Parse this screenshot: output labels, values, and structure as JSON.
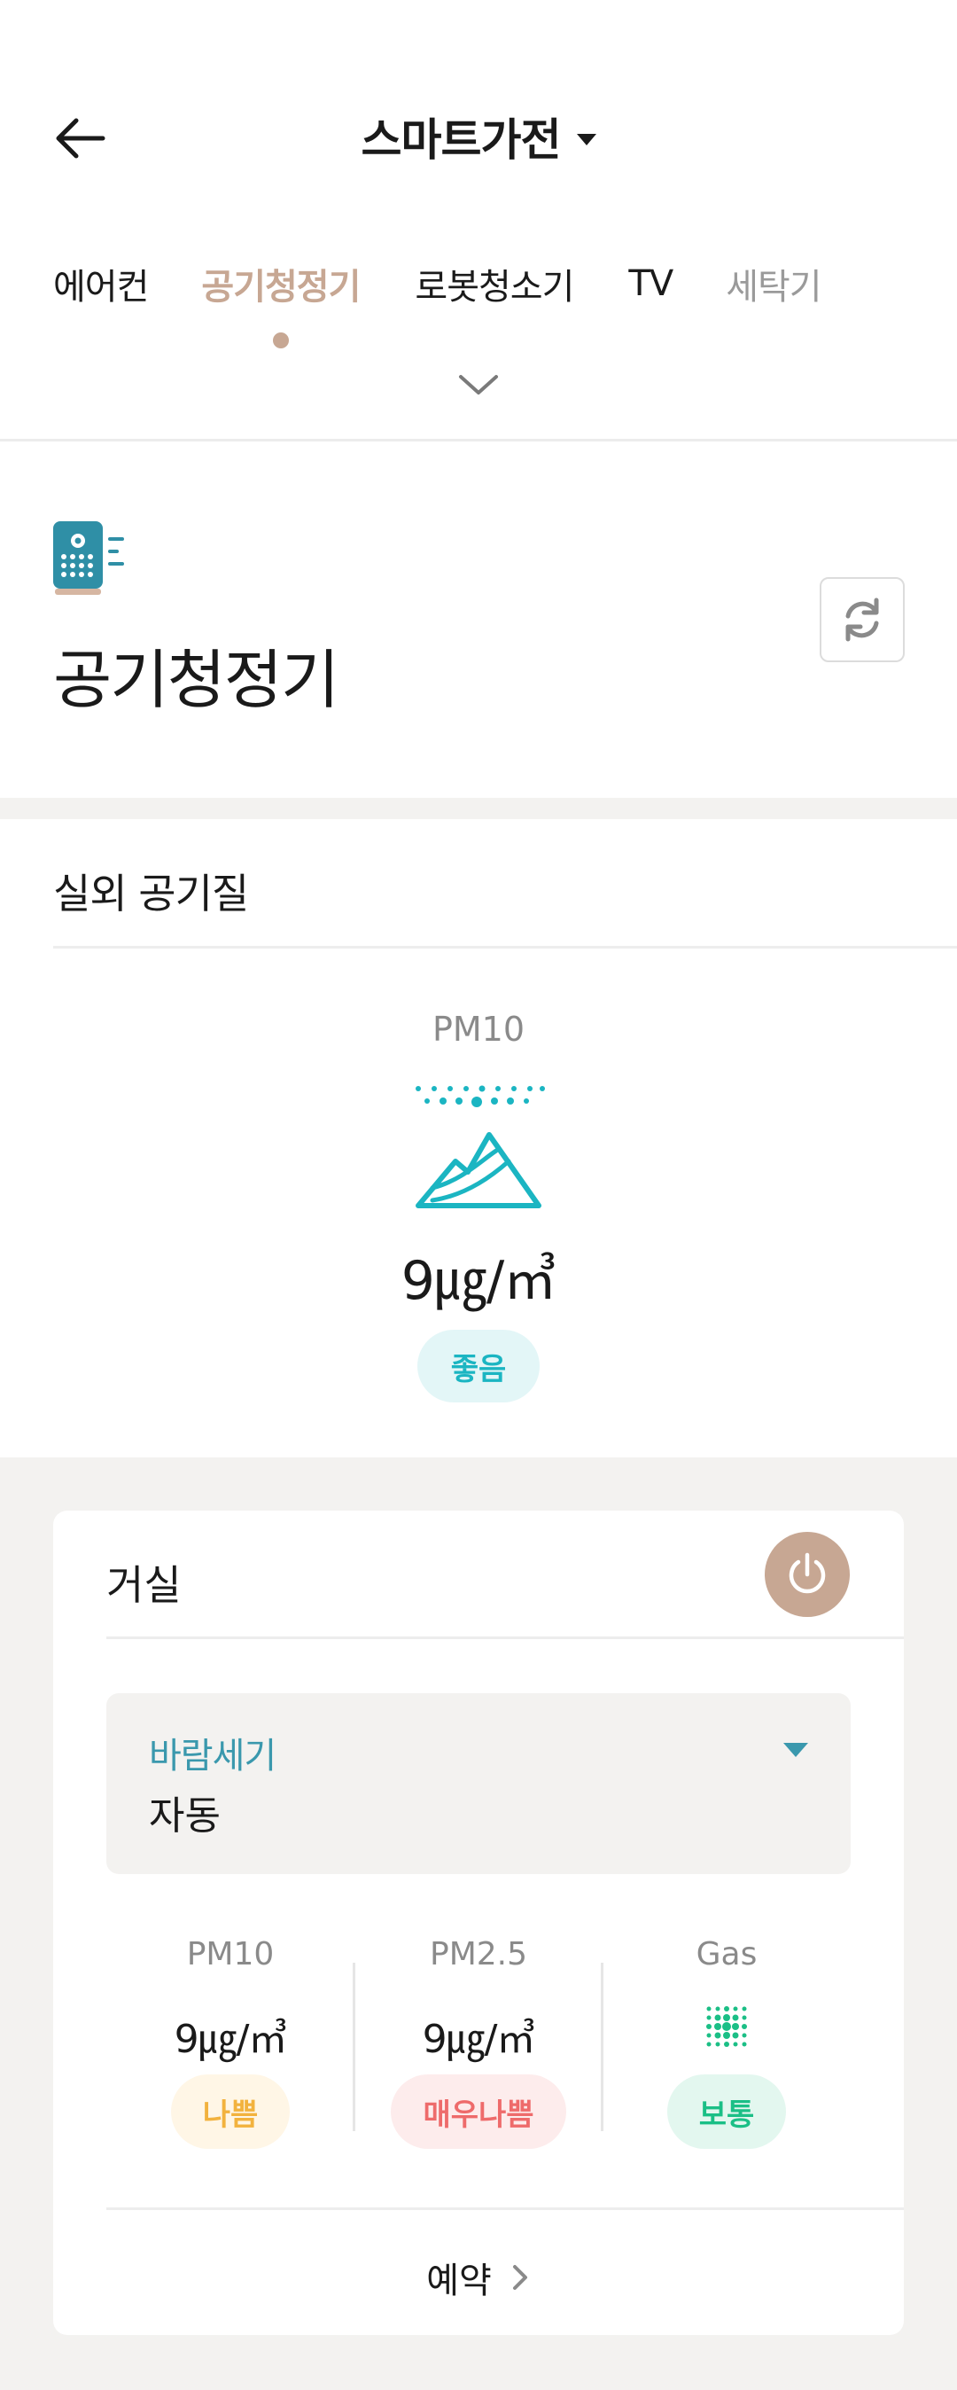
{
  "header": {
    "title": "스마트가전",
    "tabs": [
      {
        "label": "에어컨",
        "active": false
      },
      {
        "label": "공기청정기",
        "active": true
      },
      {
        "label": "로봇청소기",
        "active": false
      },
      {
        "label": "TV",
        "active": false
      },
      {
        "label": "세탁기",
        "active": false
      }
    ]
  },
  "device": {
    "title": "공기청정기",
    "icon": "air-purifier-icon"
  },
  "outdoor": {
    "title": "실외 공기질",
    "pm_label": "PM10",
    "value": "9",
    "unit": "㎍/㎥",
    "status": "좋음"
  },
  "room": {
    "name": "거실",
    "wind": {
      "label": "바람세기",
      "value": "자동"
    },
    "metrics": [
      {
        "label": "PM10",
        "value": "9",
        "unit": "㎍/㎥",
        "status": "나쁨"
      },
      {
        "label": "PM2.5",
        "value": "9",
        "unit": "㎍/㎥",
        "status": "매우나쁨"
      },
      {
        "label": "Gas",
        "value": "",
        "unit": "",
        "status": "보통"
      }
    ],
    "reserve_label": "예약"
  },
  "colors": {
    "accent": "#c7a793",
    "teal": "#1bb5c2",
    "wind_label": "#3a98ad",
    "bad": "#f2b23e",
    "very_bad": "#ee6b6b",
    "normal": "#1bbf86"
  }
}
